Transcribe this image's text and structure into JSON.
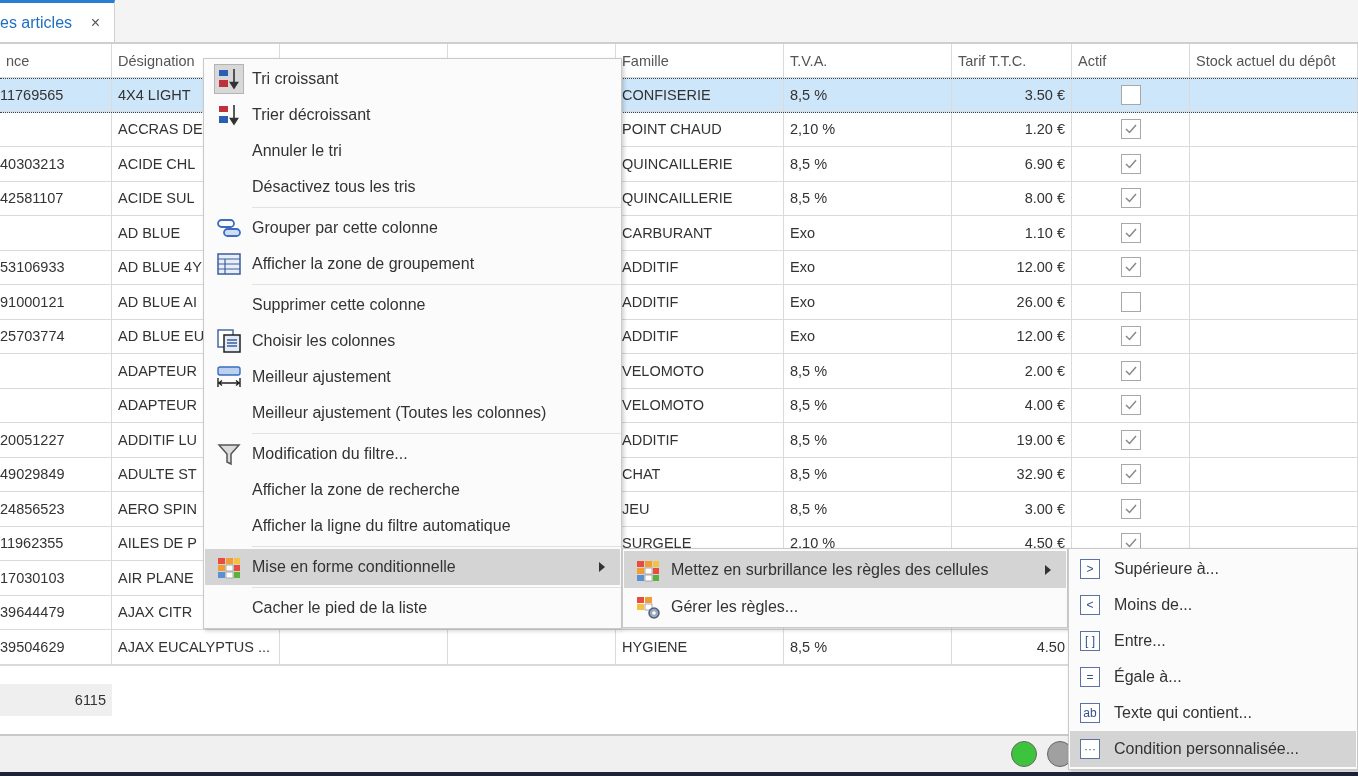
{
  "tab": {
    "label": "es articles",
    "close": "×",
    "selected": true
  },
  "grid": {
    "columns": [
      {
        "label": "nce",
        "kind": "text"
      },
      {
        "label": "Désignation",
        "kind": "text"
      },
      {
        "kind": "text"
      },
      {
        "kind": "text"
      },
      {
        "label": "Famille",
        "kind": "text"
      },
      {
        "label": "T.V.A.",
        "kind": "text"
      },
      {
        "label": "Tarif T.T.C.",
        "kind": "money"
      },
      {
        "label": "Actif",
        "kind": "check"
      },
      {
        "label": "Stock actuel du dépôt",
        "kind": "text"
      }
    ],
    "rows": [
      {
        "selected": true,
        "cells": [
          "11769565",
          "4X4 LIGHT",
          null,
          null,
          "CONFISERIE",
          "8,5 %",
          "3.50 €",
          false,
          null
        ]
      },
      {
        "selected": false,
        "cells": [
          null,
          "ACCRAS DE",
          null,
          null,
          "POINT CHAUD",
          "2,10 %",
          "1.20 €",
          true,
          null
        ]
      },
      {
        "selected": false,
        "cells": [
          "40303213",
          "ACIDE CHL",
          null,
          null,
          "QUINCAILLERIE",
          "8,5 %",
          "6.90 €",
          true,
          null
        ]
      },
      {
        "selected": false,
        "cells": [
          "42581107",
          "ACIDE SUL",
          null,
          null,
          "QUINCAILLERIE",
          "8,5 %",
          "8.00 €",
          true,
          null
        ]
      },
      {
        "selected": false,
        "cells": [
          null,
          "AD BLUE",
          null,
          null,
          "CARBURANT",
          "Exo",
          "1.10 €",
          true,
          null
        ]
      },
      {
        "selected": false,
        "cells": [
          "53106933",
          "AD BLUE 4Y",
          null,
          null,
          "ADDITIF",
          "Exo",
          "12.00 €",
          true,
          null
        ]
      },
      {
        "selected": false,
        "cells": [
          "91000121",
          "AD BLUE AI",
          null,
          null,
          "ADDITIF",
          "Exo",
          "26.00 €",
          false,
          null
        ]
      },
      {
        "selected": false,
        "cells": [
          "25703774",
          "AD BLUE EU",
          null,
          null,
          "ADDITIF",
          "Exo",
          "12.00 €",
          true,
          null
        ]
      },
      {
        "selected": false,
        "cells": [
          null,
          "ADAPTEUR",
          null,
          null,
          "VELOMOTO",
          "8,5 %",
          "2.00 €",
          true,
          null
        ]
      },
      {
        "selected": false,
        "cells": [
          null,
          "ADAPTEUR",
          null,
          null,
          "VELOMOTO",
          "8,5 %",
          "4.00 €",
          true,
          null
        ]
      },
      {
        "selected": false,
        "cells": [
          "20051227",
          "ADDITIF LU",
          null,
          null,
          "ADDITIF",
          "8,5 %",
          "19.00 €",
          true,
          null
        ]
      },
      {
        "selected": false,
        "cells": [
          "49029849",
          "ADULTE ST",
          null,
          null,
          "CHAT",
          "8,5 %",
          "32.90 €",
          true,
          null
        ]
      },
      {
        "selected": false,
        "cells": [
          "24856523",
          "AERO SPIN",
          null,
          null,
          "JEU",
          "8,5 %",
          "3.00 €",
          true,
          null
        ]
      },
      {
        "selected": false,
        "cells": [
          "11962355",
          "AILES DE P",
          null,
          null,
          "SURGELE",
          "2,10 %",
          "4.50 €",
          true,
          null
        ]
      },
      {
        "selected": false,
        "cells": [
          "17030103",
          "AIR PLANE",
          null,
          null,
          null,
          null,
          null,
          null,
          null
        ]
      },
      {
        "selected": false,
        "cells": [
          "39644479",
          "AJAX CITR",
          null,
          null,
          null,
          null,
          null,
          null,
          null
        ]
      },
      {
        "selected": false,
        "cells": [
          "39504629",
          "AJAX EUCALYPTUS ...",
          null,
          null,
          "HYGIENE",
          "8,5 %",
          "4.50",
          null,
          null
        ]
      }
    ]
  },
  "footer": {
    "count": "6115"
  },
  "status_bar": {
    "indicators": [
      {
        "color": "#3cc43c"
      },
      {
        "color": "#a0a0a0"
      }
    ]
  },
  "context_menu": {
    "groups": [
      {
        "items": [
          {
            "label": "Tri croissant",
            "kind": "sort-asc",
            "checked": true,
            "selected": false,
            "has_submenu": false
          },
          {
            "label": "Trier décroissant",
            "kind": "sort-desc",
            "checked": false,
            "selected": false,
            "has_submenu": false
          },
          {
            "label": "Annuler le tri",
            "kind": "none",
            "checked": false,
            "selected": false,
            "has_submenu": false
          },
          {
            "label": "Désactivez tous les tris",
            "kind": "none",
            "checked": false,
            "selected": false,
            "has_submenu": false
          }
        ]
      },
      {
        "items": [
          {
            "label": "Grouper par cette colonne",
            "kind": "group",
            "checked": false,
            "selected": false,
            "has_submenu": false
          },
          {
            "label": "Afficher la zone de groupement",
            "kind": "group-panel",
            "checked": false,
            "selected": false,
            "has_submenu": false
          }
        ]
      },
      {
        "items": [
          {
            "label": "Supprimer cette colonne",
            "kind": "none",
            "checked": false,
            "selected": false,
            "has_submenu": false
          },
          {
            "label": "Choisir les colonnes",
            "kind": "columns",
            "checked": false,
            "selected": false,
            "has_submenu": false
          },
          {
            "label": "Meilleur ajustement",
            "kind": "best-fit",
            "checked": false,
            "selected": false,
            "has_submenu": false
          },
          {
            "label": "Meilleur ajustement (Toutes les colonnes)",
            "kind": "none",
            "checked": false,
            "selected": false,
            "has_submenu": false
          }
        ]
      },
      {
        "items": [
          {
            "label": "Modification du filtre...",
            "kind": "filter",
            "checked": false,
            "selected": false,
            "has_submenu": false
          },
          {
            "label": "Afficher la zone de recherche",
            "kind": "none",
            "checked": false,
            "selected": false,
            "has_submenu": false
          },
          {
            "label": "Afficher la ligne du filtre automatique",
            "kind": "none",
            "checked": false,
            "selected": false,
            "has_submenu": false
          }
        ]
      },
      {
        "items": [
          {
            "label": "Mise en forme conditionnelle",
            "kind": "conditional",
            "checked": false,
            "selected": true,
            "has_submenu": true
          }
        ]
      },
      {
        "items": [
          {
            "label": "Cacher le pied de la liste",
            "kind": "none",
            "checked": false,
            "selected": false,
            "has_submenu": false
          }
        ]
      }
    ]
  },
  "submenu": {
    "items": [
      {
        "label": "Mettez en surbrillance les règles des cellules",
        "kind": "conditional",
        "selected": true,
        "has_submenu": true
      },
      {
        "label": "Gérer les règles...",
        "kind": "manage",
        "selected": false,
        "has_submenu": false
      }
    ]
  },
  "rules_menu": {
    "items": [
      {
        "glyph": ">",
        "label": "Supérieure à...",
        "selected": false
      },
      {
        "glyph": "<",
        "label": "Moins de...",
        "selected": false
      },
      {
        "glyph": "[ ]",
        "label": "Entre...",
        "selected": false
      },
      {
        "glyph": "=",
        "label": "Égale à...",
        "selected": false
      },
      {
        "glyph": "ab",
        "label": "Texte qui contient...",
        "selected": false
      },
      {
        "glyph": "···",
        "label": "Condition personnalisée...",
        "selected": true
      }
    ]
  }
}
